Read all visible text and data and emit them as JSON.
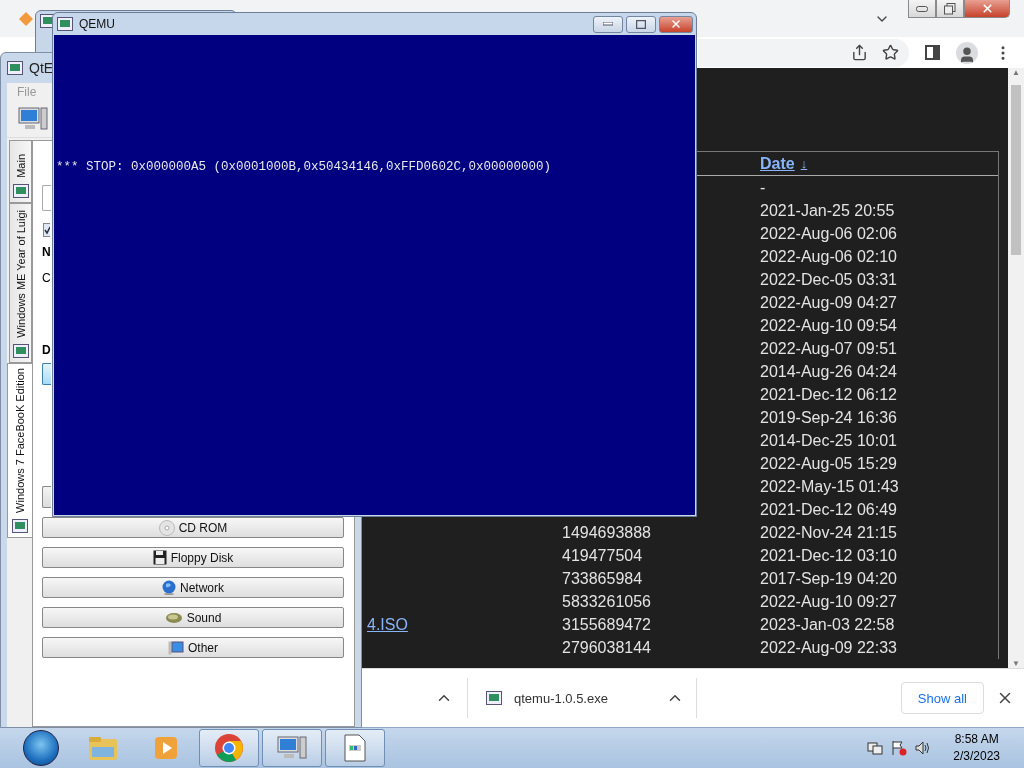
{
  "browser": {
    "tabs": [
      {
        "selected": true
      }
    ],
    "scrollbar": {
      "up": "▲",
      "down": "▼"
    },
    "listing": {
      "columns": [
        {
          "label": "Date",
          "sort_indicator": "↓"
        }
      ],
      "rows": [
        {
          "date": "-"
        },
        {
          "date": "2021-Jan-25 20:55"
        },
        {
          "date": "2022-Aug-06 02:06"
        },
        {
          "date": "2022-Aug-06 02:10"
        },
        {
          "date": "2022-Dec-05 03:31"
        },
        {
          "date": "2022-Aug-09 04:27"
        },
        {
          "date": "2022-Aug-10 09:54"
        },
        {
          "date": "2022-Aug-07 09:51"
        },
        {
          "date": "2014-Aug-26 04:24"
        },
        {
          "date": "2021-Dec-12 06:12"
        },
        {
          "date": "2019-Sep-24 16:36"
        },
        {
          "date": "2014-Dec-25 10:01"
        },
        {
          "date": "2022-Aug-05 15:29"
        },
        {
          "date": "2022-May-15 01:43"
        },
        {
          "date": "2021-Dec-12 06:49"
        },
        {
          "size": "1494693888",
          "date": "2022-Nov-24 21:15"
        },
        {
          "size": "419477504",
          "date": "2021-Dec-12 03:10"
        },
        {
          "size": "733865984",
          "date": "2017-Sep-19 04:20"
        },
        {
          "size": "5833261056",
          "date": "2022-Aug-10 09:27"
        },
        {
          "name": "4.ISO",
          "size": "3155689472",
          "date": "2023-Jan-03 22:58"
        },
        {
          "size": "2796038144",
          "date": "2022-Aug-09 22:33"
        }
      ]
    },
    "downloads": {
      "items": [
        {
          "filename": "qtemu-1.0.5.exe"
        }
      ],
      "show_all": "Show all"
    }
  },
  "qtemu": {
    "title": "QtE",
    "menu": [
      "File"
    ],
    "tabs": [
      {
        "label": "Main",
        "selected": false
      },
      {
        "label": "Windows ME Year of Luigi",
        "selected": false
      },
      {
        "label": "Windows 7 FaceBooK Edition",
        "selected": true
      }
    ],
    "checkbox_checked": true,
    "section_1": "N",
    "line_1": "C",
    "section_2": "D",
    "device_buttons": [
      {
        "label": "CD ROM",
        "kind": "cdrom"
      },
      {
        "label": "Floppy Disk",
        "kind": "floppy"
      },
      {
        "label": "Network",
        "kind": "network"
      },
      {
        "label": "Sound",
        "kind": "sound"
      },
      {
        "label": "Other",
        "kind": "other"
      }
    ]
  },
  "qemu": {
    "title": "QEMU",
    "screen_text": "*** STOP: 0x000000A5 (0x0001000B,0x50434146,0xFFD0602C,0x00000000)"
  },
  "taskbar": {
    "apps": [
      {
        "kind": "explorer",
        "running": false
      },
      {
        "kind": "media",
        "running": false
      },
      {
        "kind": "chrome",
        "running": true
      },
      {
        "kind": "qtemu",
        "running": true
      },
      {
        "kind": "file",
        "running": true
      }
    ],
    "clock": {
      "time": "8:58 AM",
      "date": "2/3/2023"
    }
  }
}
